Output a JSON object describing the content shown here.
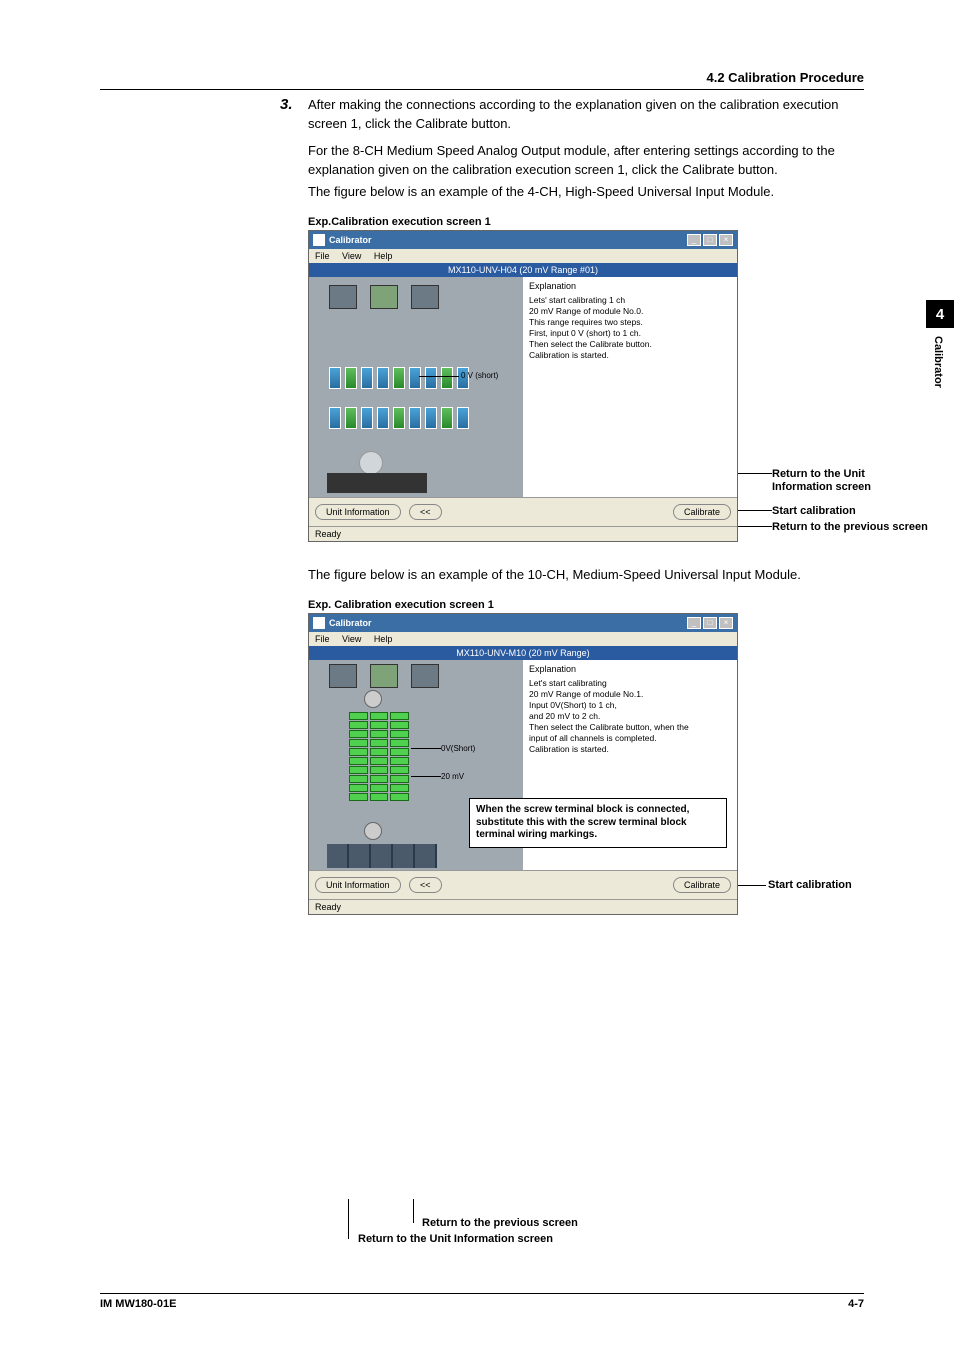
{
  "header": {
    "section": "4.2  Calibration Procedure"
  },
  "sidetab": {
    "num": "4",
    "label": "Calibrator"
  },
  "step": {
    "num": "3.",
    "text1": "After making the connections according to the explanation given on the calibration execution screen 1, click the Calibrate button.",
    "text2": "For the 8-CH Medium Speed Analog Output module, after entering settings according to the explanation given on the calibration execution screen 1, click the Calibrate button.",
    "text3": "The figure below is an example of the 4-CH, High-Speed Universal Input Module."
  },
  "fig1": {
    "caption": "Exp.Calibration execution screen 1",
    "title": "Calibrator",
    "menu": {
      "file": "File",
      "view": "View",
      "help": "Help"
    },
    "bluebar": "MX110-UNV-H04 (20 mV Range #01)",
    "explanation_title": "Explanation",
    "exp_lines": [
      "Lets' start calibrating 1 ch",
      "20 mV Range of module No.0.",
      "This range requires two steps.",
      "First, input 0 V (short) to 1 ch.",
      "Then select the Calibrate button.",
      "Calibration is started."
    ],
    "short_label": "0 V (short)",
    "btn_unit": "Unit Information",
    "btn_back": "<<",
    "btn_calibrate": "Calibrate",
    "status": "Ready",
    "callouts": {
      "c1a": "Return to the Unit",
      "c1b": "Information screen",
      "c2": "Start calibration",
      "c3": "Return to the previous screen"
    }
  },
  "mid_para": "The figure below is an example of the 10-CH, Medium-Speed Universal Input Module.",
  "fig2": {
    "caption": "Exp.   Calibration execution screen 1",
    "title": "Calibrator",
    "menu": {
      "file": "File",
      "view": "View",
      "help": "Help"
    },
    "bluebar": "MX110-UNV-M10 (20 mV Range)",
    "explanation_title": "Explanation",
    "exp_lines": [
      "Let's start calibrating",
      "20 mV Range of module No.1.",
      "Input 0V(Short) to 1 ch,",
      "and 20 mV to 2 ch.",
      "Then select the Calibrate button, when the",
      "input of all channels is completed.",
      "Calibration is started."
    ],
    "lbl_short": "0V(Short)",
    "lbl_20mv": "20 mV",
    "overlay": "When the screw terminal block is connected, substitute this with the screw terminal block terminal wiring markings.",
    "btn_unit": "Unit Information",
    "btn_back": "<<",
    "btn_calibrate": "Calibrate",
    "status": "Ready",
    "callouts": {
      "start": "Start calibration",
      "prev": "Return to the previous screen",
      "unit": "Return to the Unit Information screen"
    }
  },
  "footer": {
    "left": "IM MW180-01E",
    "right": "4-7"
  }
}
